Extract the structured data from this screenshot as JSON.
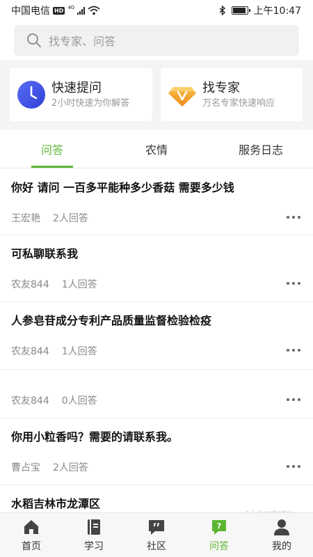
{
  "status_bar": {
    "carrier": "中国电信",
    "hd": "HD",
    "network": "4G",
    "time": "上午10:47"
  },
  "search": {
    "placeholder": "找专家、问答"
  },
  "quick_cards": [
    {
      "title": "快速提问",
      "subtitle": "2小时快速为你解答",
      "icon": "clock-icon",
      "color": "#4455e8"
    },
    {
      "title": "找专家",
      "subtitle": "万名专家快速响应",
      "icon": "diamond-v-icon",
      "color": "#f2a22e"
    }
  ],
  "tabs": [
    {
      "label": "问答",
      "active": true
    },
    {
      "label": "农情",
      "active": false
    },
    {
      "label": "服务日志",
      "active": false
    }
  ],
  "questions": [
    {
      "title": "你好 请问 一百多平能种多少香菇 需要多少钱",
      "author": "王宏艳",
      "answers": "2人回答"
    },
    {
      "title": "可私聊联系我",
      "author": "农友844",
      "answers": "1人回答"
    },
    {
      "title": "人参皂苷成分专利产品质量监督检验检疫",
      "author": "农友844",
      "answers": "1人回答"
    },
    {
      "title": "",
      "author": "农友844",
      "answers": "0人回答"
    },
    {
      "title": "你用小粒香吗？需要的请联系我。",
      "author": "曹占宝",
      "answers": "2人回答"
    },
    {
      "title": "水稻吉林市龙潭区",
      "author": "",
      "answers": ""
    }
  ],
  "bottom_nav": [
    {
      "label": "首页",
      "icon": "home-icon",
      "active": false
    },
    {
      "label": "学习",
      "icon": "book-icon",
      "active": false
    },
    {
      "label": "社区",
      "icon": "chat-icon",
      "active": false
    },
    {
      "label": "问答",
      "icon": "qa-icon",
      "active": true
    },
    {
      "label": "我的",
      "icon": "profile-icon",
      "active": false
    }
  ],
  "colors": {
    "accent": "#5cb531",
    "clock_icon": "#4455e8",
    "expert_icon": "#f2a22e"
  }
}
